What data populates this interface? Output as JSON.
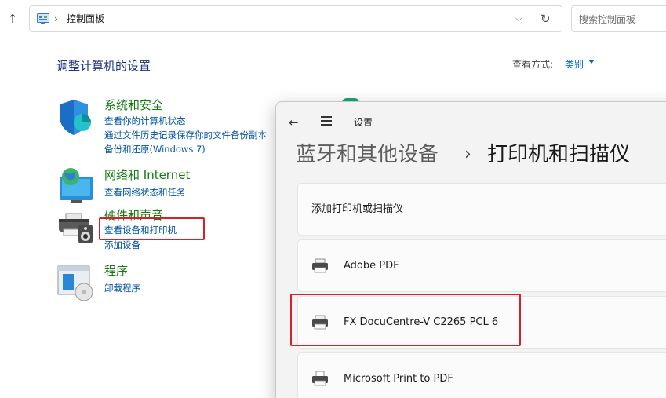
{
  "address_bar": {
    "location": "控制面板",
    "separator": "›",
    "dropdown_icon": "chevron-down-icon",
    "refresh_icon": "refresh-icon"
  },
  "search": {
    "placeholder": "搜索控制面板"
  },
  "header": {
    "title": "调整计算机的设置",
    "view_by_label": "查看方式:",
    "view_by_value": "类别"
  },
  "categories": [
    {
      "title": "系统和安全",
      "icon": "shield-icon",
      "links": [
        "查看你的计算机状态",
        "通过文件历史记录保存你的文件备份副本",
        "备份和还原(Windows 7)"
      ]
    },
    {
      "title": "网络和 Internet",
      "icon": "globe-network-icon",
      "links": [
        "查看网络状态和任务"
      ]
    },
    {
      "title": "硬件和声音",
      "icon": "printer-speaker-icon",
      "links": [
        "查看设备和打印机",
        "添加设备"
      ]
    },
    {
      "title": "程序",
      "icon": "programs-disc-icon",
      "links": [
        "卸载程序"
      ]
    }
  ],
  "settings": {
    "app_title": "设置",
    "back_icon": "back-arrow-icon",
    "menu_icon": "hamburger-menu-icon",
    "breadcrumb_parent": "蓝牙和其他设备",
    "breadcrumb_separator": "›",
    "breadcrumb_current": "打印机和扫描仪",
    "add_label": "添加打印机或扫描仪",
    "printers": [
      "Adobe PDF",
      "FX DocuCentre-V C2265 PCL 6",
      "Microsoft Print to PDF"
    ]
  },
  "colors": {
    "accent_link": "#0054a6",
    "category_green": "#107c10",
    "title_blue": "#1e3287",
    "highlight_red": "#d9202a"
  }
}
